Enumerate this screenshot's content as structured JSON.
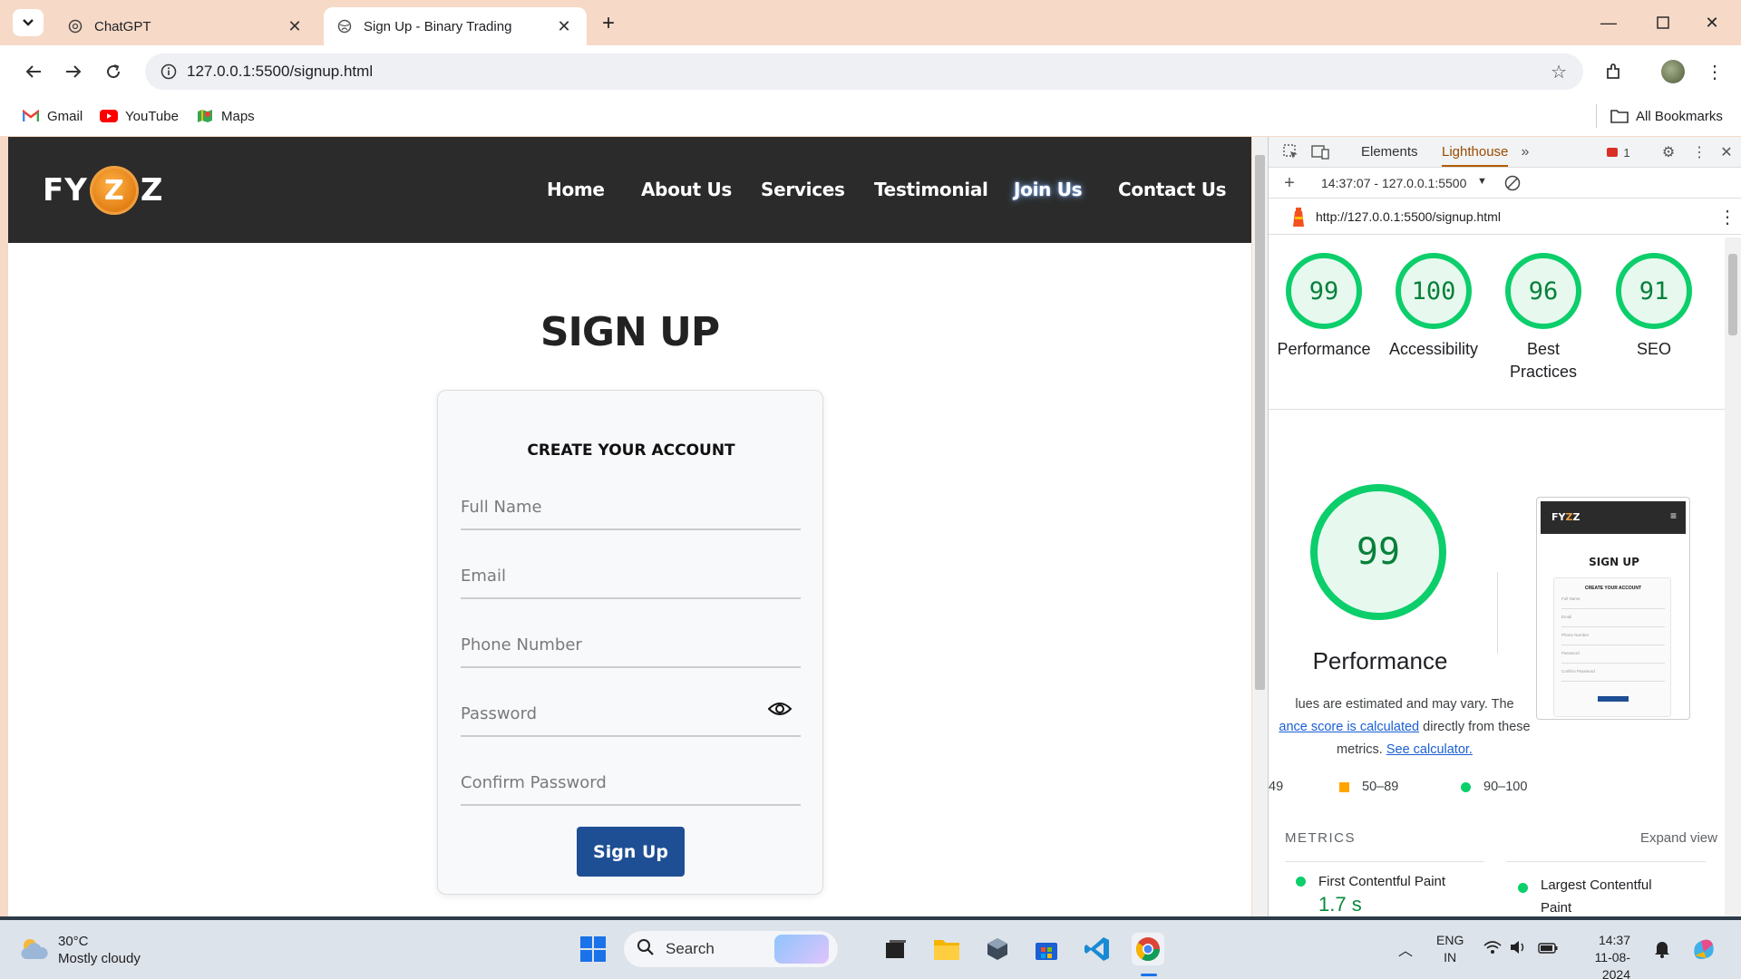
{
  "browser": {
    "tabs": [
      {
        "title": "ChatGPT",
        "active": false
      },
      {
        "title": "Sign Up - Binary Trading",
        "active": true
      }
    ],
    "url": "127.0.0.1:5500/signup.html",
    "bookmarks": [
      {
        "label": "Gmail",
        "icon": "gmail-icon"
      },
      {
        "label": "YouTube",
        "icon": "youtube-icon"
      },
      {
        "label": "Maps",
        "icon": "maps-icon"
      }
    ],
    "all_bookmarks": "All Bookmarks"
  },
  "site": {
    "logo": {
      "left": "FY",
      "coin": "Z",
      "right": "Z"
    },
    "nav": [
      "Home",
      "About Us",
      "Services",
      "Testimonial",
      "Join Us",
      "Contact Us"
    ],
    "active_nav": "Join Us",
    "page_title": "SIGN UP",
    "card_title": "CREATE YOUR ACCOUNT",
    "fields": [
      "Full Name",
      "Email",
      "Phone Number",
      "Password",
      "Confirm Password"
    ],
    "submit_label": "Sign Up",
    "accent_color": "#1e4f94"
  },
  "devtools": {
    "tabs": [
      "Elements",
      "Lighthouse"
    ],
    "selected_tab": "Lighthouse",
    "issues_count": "1",
    "report_select": "14:37:07 - 127.0.0.1:5500",
    "report_url": "http://127.0.0.1:5500/signup.html",
    "scores": [
      {
        "value": "99",
        "label": "Performance"
      },
      {
        "value": "100",
        "label": "Accessibility"
      },
      {
        "value": "96",
        "label": "Best Practices"
      },
      {
        "value": "91",
        "label": "SEO"
      }
    ],
    "big_score": "99",
    "big_label": "Performance",
    "note_part1": "lues are estimated and may vary. The",
    "note_link1": "ance score is calculated",
    "note_part2": "directly from these",
    "note_part3": "metrics.",
    "note_link2": "See calculator.",
    "legend": [
      "49",
      "50–89",
      "90–100"
    ],
    "metrics_heading": "METRICS",
    "expand_view": "Expand view",
    "metrics": [
      {
        "name": "First Contentful Paint",
        "value": "1.7 s"
      },
      {
        "name": "Largest Contentful Paint",
        "value": ""
      }
    ],
    "thumbnail": {
      "title": "SIGN UP",
      "subtitle": "CREATE YOUR ACCOUNT",
      "fields": [
        "Full Name",
        "Email",
        "Phone Number",
        "Password",
        "Confirm Password"
      ]
    },
    "good_color": "#0cce6b"
  },
  "taskbar": {
    "temperature": "30°C",
    "weather": "Mostly cloudy",
    "search_placeholder": "Search",
    "language": "ENG",
    "region": "IN",
    "time": "14:37",
    "date": "11-08-2024"
  }
}
